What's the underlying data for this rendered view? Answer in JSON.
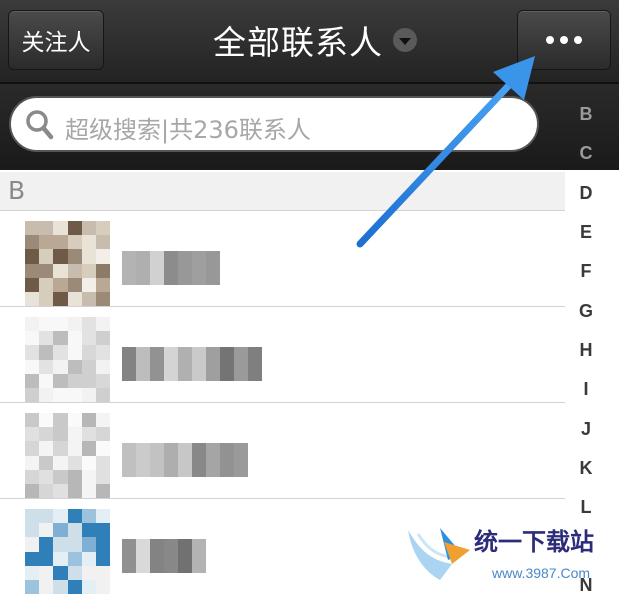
{
  "header": {
    "follow_button": "关注人",
    "title": "全部联系人"
  },
  "search": {
    "placeholder": "超级搜索|共236联系人"
  },
  "sections": [
    {
      "letter": "B"
    }
  ],
  "index_letters": [
    "B",
    "C",
    "D",
    "E",
    "F",
    "G",
    "H",
    "I",
    "J",
    "K",
    "L",
    "N"
  ],
  "watermark": {
    "brand": "统一下载站",
    "url": "www.3987.Com"
  },
  "colors": {
    "arrow": "#2f86e0",
    "topbar": "#2e2e2e"
  }
}
